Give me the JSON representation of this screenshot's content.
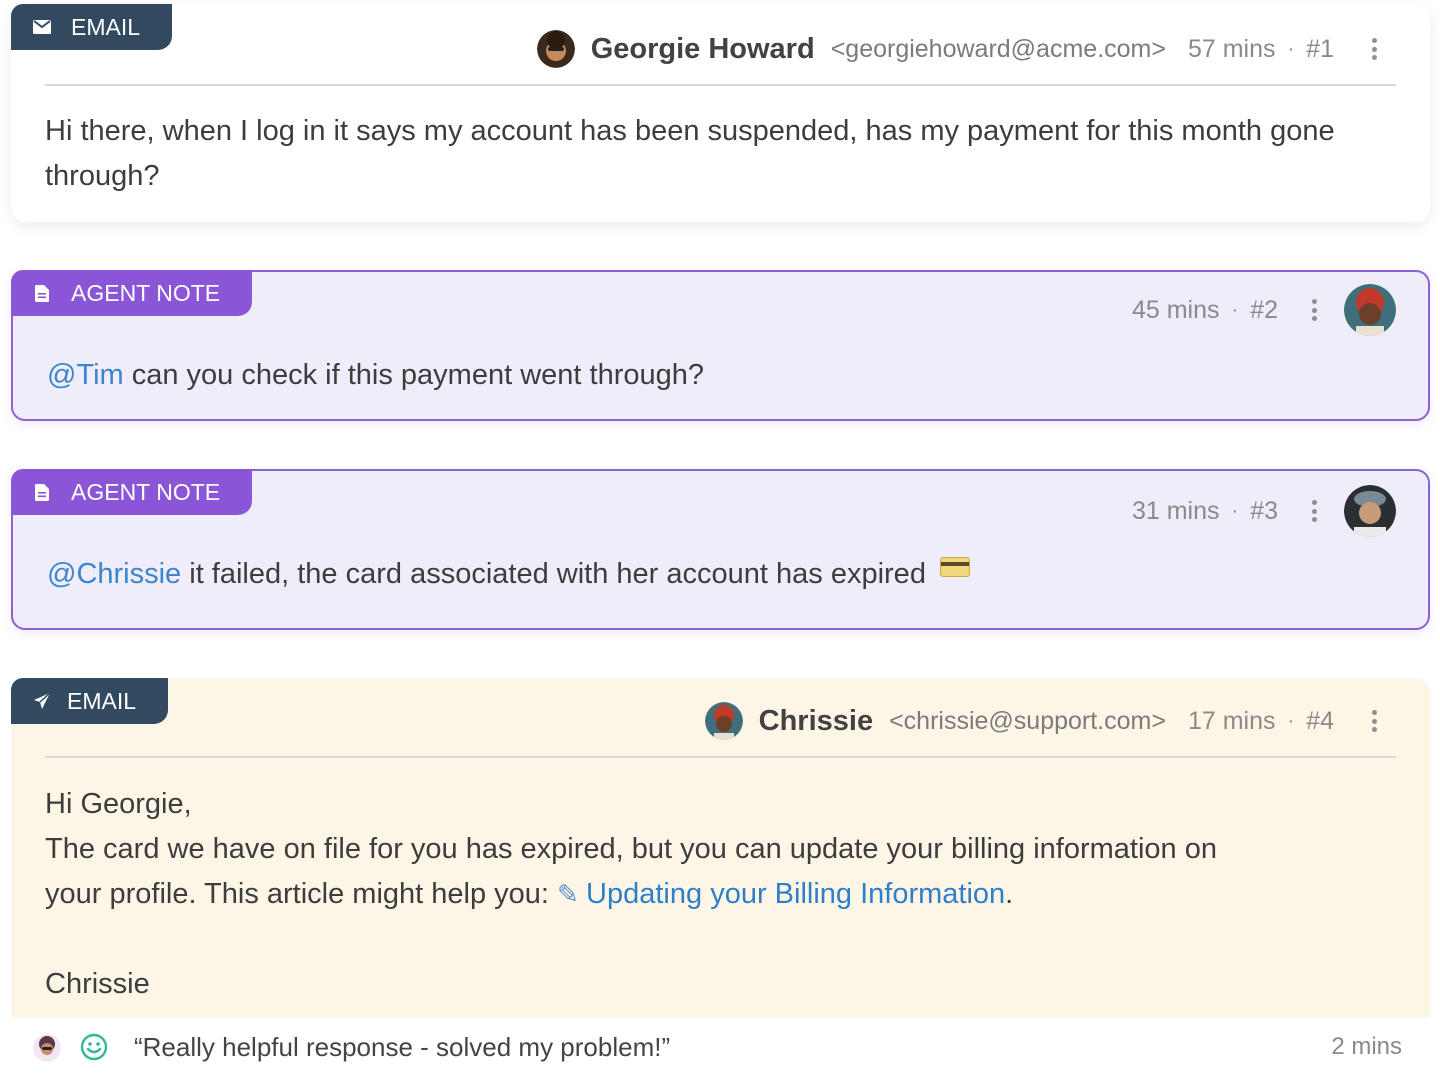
{
  "messages": [
    {
      "tag": "EMAIL",
      "icon": "envelope-icon",
      "sender_name": "Georgie Howard",
      "sender_email": "<georgiehoward@acme.com>",
      "time": "57 mins",
      "number": "#1",
      "body": "Hi there, when I log in it says my account has been suspended, has my payment for this month gone through?"
    },
    {
      "tag": "AGENT NOTE",
      "icon": "document-icon",
      "time": "45 mins",
      "number": "#2",
      "mention": "@Tim",
      "body": " can you check if this payment went through?"
    },
    {
      "tag": "AGENT NOTE",
      "icon": "document-icon",
      "time": "31 mins",
      "number": "#3",
      "mention": "@Chrissie",
      "body": " it failed, the card associated with her account has expired"
    },
    {
      "tag": "EMAIL",
      "icon": "paper-plane-icon",
      "sender_name": "Chrissie",
      "sender_email": "<chrissie@support.com>",
      "time": "17 mins",
      "number": "#4",
      "greeting": "Hi Georgie,",
      "body_line1": "The card we have on file for you has expired, but you can update your billing information on",
      "body_line2_prefix": "your profile. This article might help you: ",
      "link_text": "Updating your Billing Information",
      "body_line2_suffix": ".",
      "signature": "Chrissie"
    }
  ],
  "feedback": {
    "quote": "“Really helpful response - solved my problem!”",
    "time": "2 mins",
    "icon": "smiley-icon"
  },
  "separator": "·",
  "colors": {
    "email_tag": "#324a5f",
    "note_tag": "#8a55d6",
    "note_border": "#8a63d2",
    "note_bg": "#f0edfb",
    "reply_bg": "#fdf6e7",
    "mention": "#3b86cc"
  }
}
